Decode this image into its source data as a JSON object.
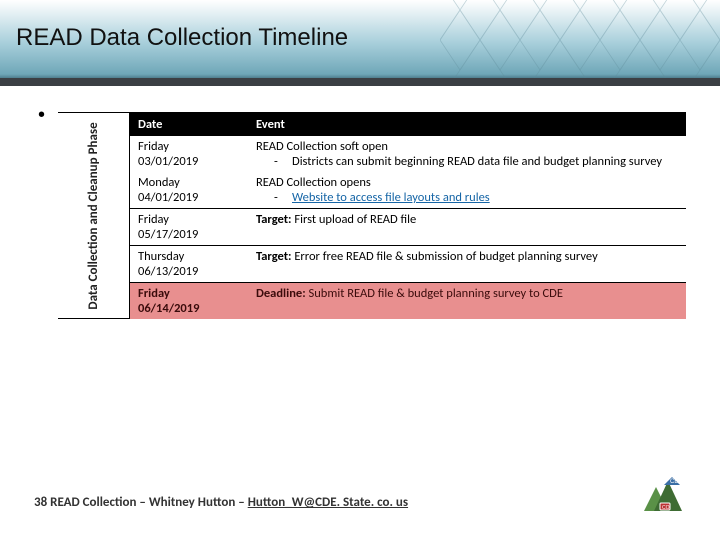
{
  "title": "READ Data Collection Timeline",
  "phase_label": "Data Collection and Cleanup Phase",
  "headers": {
    "date": "Date",
    "event": "Event"
  },
  "rows": {
    "r1": {
      "dow": "Friday",
      "date": "03/01/2019",
      "ev_line1": "READ Collection soft open",
      "sub1": "Districts can submit beginning READ data file and budget planning survey"
    },
    "r2": {
      "dow": "Monday",
      "date": "04/01/2019",
      "ev_line1": "READ Collection opens",
      "sub1": "Website to access file layouts and rules"
    },
    "r3": {
      "dow": "Friday",
      "date": "05/17/2019",
      "target": "Target:",
      "ev": "First upload of READ file"
    },
    "r4": {
      "dow": "Thursday",
      "date": "06/13/2019",
      "target": "Target:",
      "ev": "Error free READ file & submission of budget planning survey"
    },
    "r5": {
      "dow": "Friday",
      "date": "06/14/2019",
      "deadline": "Deadline:",
      "ev": "Submit READ file & budget planning survey to CDE"
    }
  },
  "footer": {
    "slide_number": "38",
    "text": "READ Collection – Whitney Hutton – ",
    "email": "Hutton_W@CDE. State. co. us"
  },
  "logo_alt": "CDE"
}
